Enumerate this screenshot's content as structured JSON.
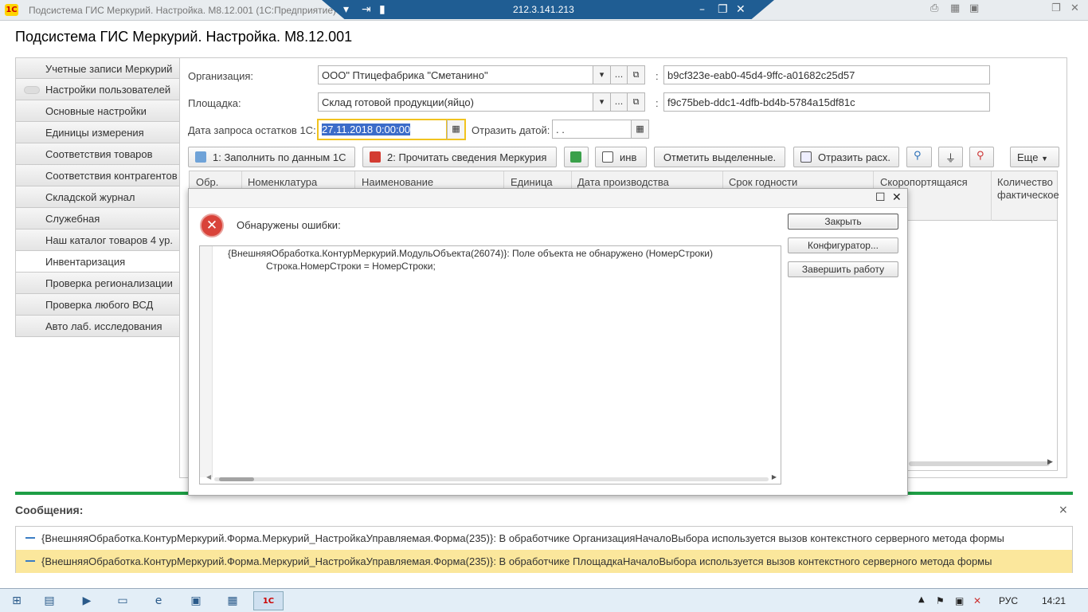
{
  "window": {
    "title": "Подсистема ГИС Меркурий. Настройка. М8.12.001  (1С:Предприятие)",
    "logo": "1С",
    "rdp_ip": "212.3.141.213"
  },
  "page_title": "Подсистема ГИС Меркурий. Настройка. М8.12.001",
  "sidebar": {
    "items": [
      {
        "label": "Учетные записи Меркурий"
      },
      {
        "label": "Настройки пользователей"
      },
      {
        "label": "Основные настройки"
      },
      {
        "label": "Единицы измерения"
      },
      {
        "label": "Соответствия товаров"
      },
      {
        "label": "Соответствия контрагентов"
      },
      {
        "label": "Складской журнал"
      },
      {
        "label": "Служебная"
      },
      {
        "label": "Наш каталог товаров 4 ур."
      },
      {
        "label": "Инвентаризация"
      },
      {
        "label": "Проверка регионализации"
      },
      {
        "label": "Проверка любого ВСД"
      },
      {
        "label": "Авто лаб. исследования"
      }
    ]
  },
  "form": {
    "org_label": "Организация:",
    "org_value": "ООО\" Птицефабрика \"Сметанино\"",
    "org_guid": "b9cf323e-eab0-45d4-9ffc-a01682c25d57",
    "site_label": "Площадка:",
    "site_value": "Склад готовой продукции(яйцо)",
    "site_guid": "f9c75beb-ddc1-4dfb-bd4b-5784a15df81c",
    "date_label": "Дата запроса остатков 1С:",
    "date_value": "27.11.2018  0:00:00",
    "reflect_label": "Отразить датой:",
    "reflect_value": " .  .",
    "colon": ":"
  },
  "toolbar": {
    "fill_1c": "1: Заполнить по данным 1С",
    "read_merc": "2: Прочитать сведения Меркурия",
    "inv": "инв",
    "mark_selected": "Отметить выделенные.",
    "reflect_exp": "Отразить расх.",
    "more": "Еще"
  },
  "grid": {
    "columns": [
      "Обр.",
      "Номенклатура",
      "Наименование",
      "Единица",
      "Дата производства",
      "Срок годности",
      "Скоропортящаяся",
      "Количество фактическое"
    ]
  },
  "dialog": {
    "message": "Обнаружены ошибки:",
    "code_line1": "{ВнешняяОбработка.КонтурМеркурий.МодульОбъекта(26074)}: Поле объекта не обнаружено (НомерСтроки)",
    "code_line2": "Строка.НомерСтроки = НомерСтроки;",
    "btn_close": "Закрыть",
    "btn_config": "Конфигуратор...",
    "btn_exit": "Завершить работу"
  },
  "messages": {
    "title": "Сообщения:",
    "items": [
      "{ВнешняяОбработка.КонтурМеркурий.Форма.Меркурий_НастройкаУправляемая.Форма(235)}: В обработчике ОрганизацияНачалоВыбора используется вызов контекстного серверного метода формы",
      "{ВнешняяОбработка.КонтурМеркурий.Форма.Меркурий_НастройкаУправляемая.Форма(235)}: В обработчике ПлощадкаНачалоВыбора используется вызов контекстного серверного метода формы"
    ]
  },
  "taskbar": {
    "lang": "РУС",
    "time": "14:21"
  },
  "colors": {
    "accent_green": "#1e9e45",
    "highlight_yellow": "#fbe79c",
    "error_red": "#d9433a",
    "rdp_blue": "#1f5d93"
  }
}
